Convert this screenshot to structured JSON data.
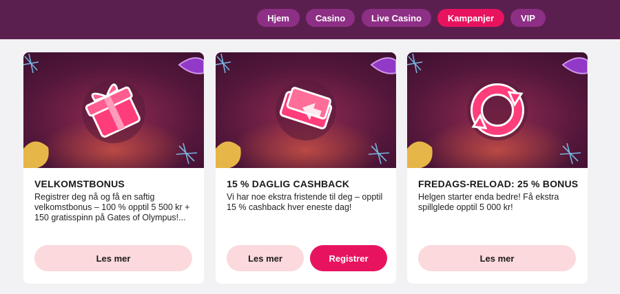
{
  "nav": {
    "items": [
      {
        "label": "Hjem",
        "active": false
      },
      {
        "label": "Casino",
        "active": false
      },
      {
        "label": "Live Casino",
        "active": false
      },
      {
        "label": "Kampanjer",
        "active": true
      },
      {
        "label": "VIP",
        "active": false
      }
    ]
  },
  "colors": {
    "header_bg": "#5b1f4f",
    "nav_pill": "#8e2f86",
    "accent": "#e8135f",
    "button_light": "#fbd9dc"
  },
  "cards": [
    {
      "icon": "gift-icon",
      "title": "VELKOMSTBONUS",
      "description": "Registrer deg nå og få en saftig velkomstbonus – 100 % opptil 5 500 kr + 150 gratisspinn på Gates of Olympus!...",
      "read_more": "Les mer"
    },
    {
      "icon": "cash-icon",
      "title": "15 % DAGLIG CASHBACK",
      "description": "Vi har noe ekstra fristende til deg – opptil 15 % cashback hver eneste dag!",
      "read_more": "Les mer",
      "register": "Registrer"
    },
    {
      "icon": "reload-icon",
      "title": "FREDAGS-RELOAD: 25 % BONUS",
      "description": "Helgen starter enda bedre! Få ekstra spillglede opptil 5 000 kr!",
      "read_more": "Les mer"
    }
  ]
}
